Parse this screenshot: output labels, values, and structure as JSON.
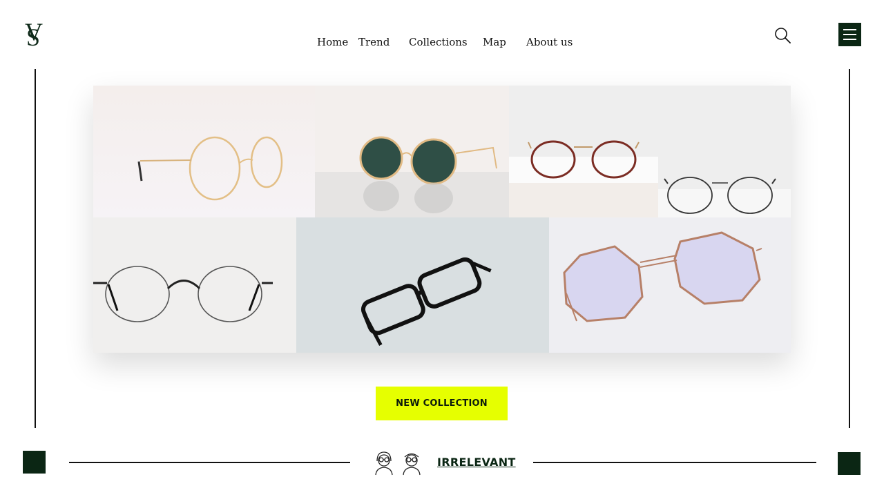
{
  "brand": {
    "letter_top": "V",
    "letter_bottom": "S"
  },
  "nav": [
    {
      "label": "Home"
    },
    {
      "label": "Trend"
    },
    {
      "label": "Collections"
    },
    {
      "label": "Map"
    },
    {
      "label": "About us"
    }
  ],
  "header": {
    "search_icon": "search-icon",
    "menu_icon": "hamburger-menu-icon"
  },
  "gallery": {
    "images": [
      {
        "subject": "gold round eyeglasses"
      },
      {
        "subject": "gold round sunglasses with green lenses"
      },
      {
        "subject": "tortoise and black metal round frames"
      },
      {
        "subject": "thin black round metal frames"
      },
      {
        "subject": "black rectangular eyeglasses"
      },
      {
        "subject": "octagonal rose gold frames with tinted lenses"
      }
    ]
  },
  "cta": {
    "label": "NEW COLLECTION"
  },
  "footer": {
    "label": "IRRELEVANT",
    "icon": "couple-with-glasses-icon"
  },
  "colors": {
    "accent": "#e6ff00",
    "brand_dark": "#0b2614"
  }
}
